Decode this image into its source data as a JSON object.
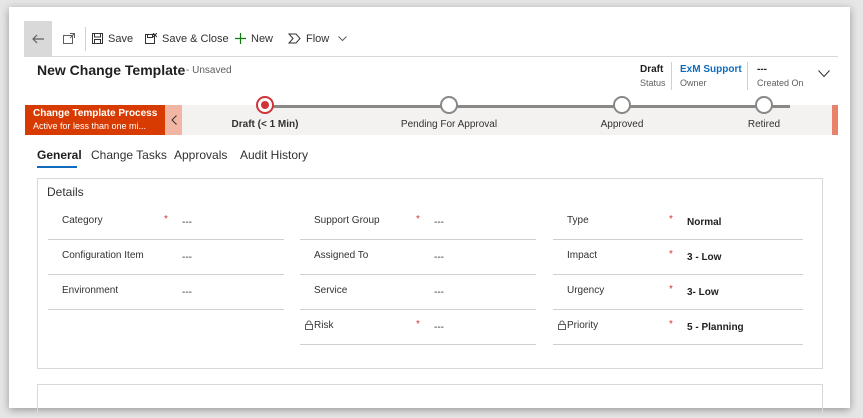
{
  "toolbar": {
    "save": "Save",
    "save_close": "Save & Close",
    "new": "New",
    "flow": "Flow"
  },
  "header": {
    "title": "New Change Template",
    "suffix": "- Unsaved",
    "status_value": "Draft",
    "status_label": "Status",
    "owner_value": "ExM Support",
    "owner_label": "Owner",
    "created_value": "---",
    "created_label": "Created On",
    "owner_color": "#0f6cbd"
  },
  "bpf": {
    "name": "Change Template Process",
    "sub": "Active for less than one mi...",
    "stages": [
      {
        "label": "Draft  (< 1 Min)",
        "active": true
      },
      {
        "label": "Pending For Approval",
        "active": false
      },
      {
        "label": "Approved",
        "active": false
      },
      {
        "label": "Retired",
        "active": false
      }
    ]
  },
  "tabs": [
    {
      "label": "General",
      "active": true
    },
    {
      "label": "Change Tasks",
      "active": false
    },
    {
      "label": "Approvals",
      "active": false
    },
    {
      "label": "Audit History",
      "active": false
    }
  ],
  "section": {
    "title": "Details",
    "col1": [
      {
        "label": "Category",
        "required": true,
        "value": "---"
      },
      {
        "label": "Configuration Item",
        "required": false,
        "value": "---"
      },
      {
        "label": "Environment",
        "required": false,
        "value": "---"
      }
    ],
    "col2": [
      {
        "label": "Support Group",
        "required": true,
        "value": "---",
        "locked": false
      },
      {
        "label": "Assigned To",
        "required": false,
        "value": "---",
        "locked": false
      },
      {
        "label": "Service",
        "required": false,
        "value": "---",
        "locked": false
      },
      {
        "label": "Risk",
        "required": true,
        "value": "---",
        "locked": true
      }
    ],
    "col3": [
      {
        "label": "Type",
        "required": true,
        "value": "Normal",
        "locked": false
      },
      {
        "label": "Impact",
        "required": true,
        "value": "3 - Low",
        "locked": false
      },
      {
        "label": "Urgency",
        "required": true,
        "value": "3- Low",
        "locked": false
      },
      {
        "label": "Priority",
        "required": true,
        "value": "5 - Planning",
        "locked": true
      }
    ]
  },
  "required_marker": "*",
  "colors": {
    "process_accent": "#d83b01",
    "active_stage": "#d13438",
    "tab_underline": "#0f6cbd"
  }
}
